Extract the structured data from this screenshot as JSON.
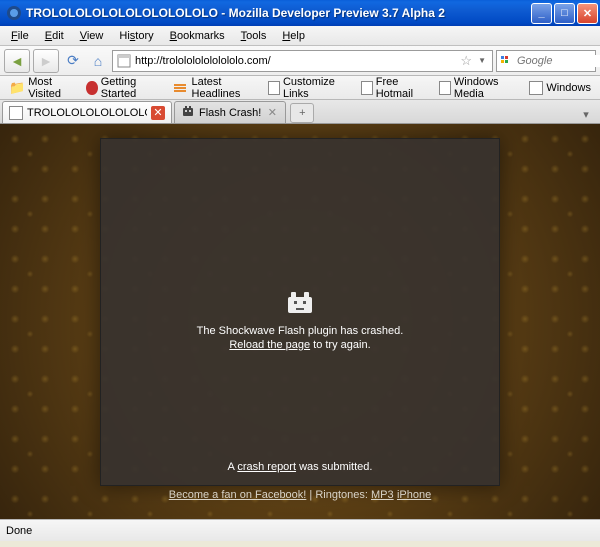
{
  "window": {
    "title": "TROLOLOLOLOLOLOLOLOLOLO - Mozilla Developer Preview 3.7 Alpha 2"
  },
  "menu": {
    "file": "File",
    "edit": "Edit",
    "view": "View",
    "history": "History",
    "bookmarks": "Bookmarks",
    "tools": "Tools",
    "help": "Help"
  },
  "toolbar": {
    "url": "http://trololololololololo.com/",
    "search_placeholder": "Google"
  },
  "bookmarks": {
    "most_visited": "Most Visited",
    "getting_started": "Getting Started",
    "latest_headlines": "Latest Headlines",
    "customize_links": "Customize Links",
    "free_hotmail": "Free Hotmail",
    "windows_media": "Windows Media",
    "windows": "Windows"
  },
  "tabs": [
    {
      "title": "TROLOLOLOLOLOLOLOLOLOLO",
      "active": true
    },
    {
      "title": "Flash Crash!",
      "active": false
    }
  ],
  "crash": {
    "message": "The Shockwave Flash plugin has crashed.",
    "reload_prefix": "Reload the page",
    "reload_suffix": " to try again.",
    "report_prefix": "A ",
    "report_link": "crash report",
    "report_suffix": " was submitted."
  },
  "footer": {
    "fb": "Become a fan on Facebook!",
    "sep": " | ",
    "ring": "Ringtones: ",
    "mp3": "MP3",
    "iphone": "iPhone"
  },
  "status": {
    "text": "Done"
  }
}
